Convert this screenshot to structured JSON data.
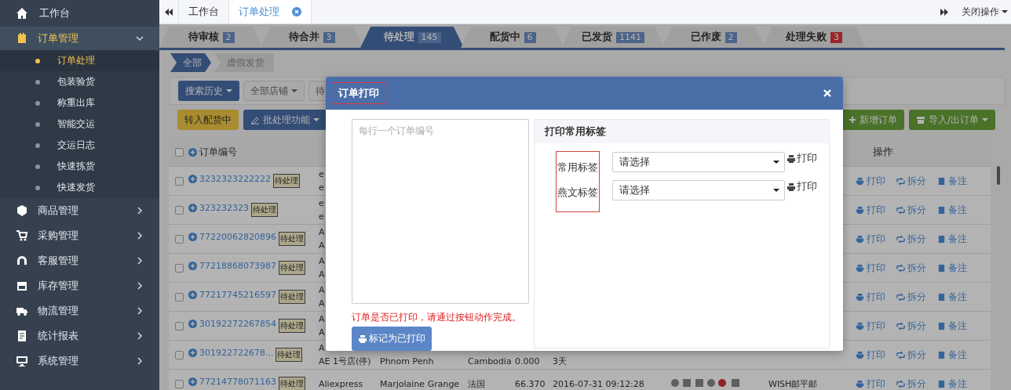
{
  "sidebar": {
    "home": {
      "label": "工作台"
    },
    "sections": [
      {
        "label": "订单管理",
        "expanded": true,
        "children": [
          {
            "label": "订单处理",
            "selected": true
          },
          {
            "label": "包装验货",
            "selected": false
          },
          {
            "label": "称重出库",
            "selected": false
          },
          {
            "label": "智能交运",
            "selected": false
          },
          {
            "label": "交运日志",
            "selected": false
          },
          {
            "label": "快速拣货",
            "selected": false
          },
          {
            "label": "快速发货",
            "selected": false
          }
        ]
      },
      {
        "label": "商品管理",
        "expanded": false
      },
      {
        "label": "采购管理",
        "expanded": false
      },
      {
        "label": "客服管理",
        "expanded": false
      },
      {
        "label": "库存管理",
        "expanded": false
      },
      {
        "label": "物流管理",
        "expanded": false
      },
      {
        "label": "统计报表",
        "expanded": false
      },
      {
        "label": "系统管理",
        "expanded": false
      }
    ]
  },
  "top_tabs": [
    {
      "label": "工作台",
      "selected": false,
      "closable": false
    },
    {
      "label": "订单处理",
      "selected": true,
      "closable": true
    }
  ],
  "top_right": {
    "menu": "关闭操作"
  },
  "status_tabs": [
    {
      "label": "待审核",
      "count": "2",
      "selected": false,
      "color": "#4c648a"
    },
    {
      "label": "待合并",
      "count": "3",
      "selected": false,
      "color": "#4c648a"
    },
    {
      "label": "待处理",
      "count": "145",
      "selected": true,
      "color": "#4c648a"
    },
    {
      "label": "配货中",
      "count": "6",
      "selected": false,
      "color": "#4c648a"
    },
    {
      "label": "已发货",
      "count": "1141",
      "selected": false,
      "color": "#4c648a"
    },
    {
      "label": "已作废",
      "count": "2",
      "selected": false,
      "color": "#4c648a"
    },
    {
      "label": "处理失败",
      "count": "3",
      "selected": false,
      "color": "#98262b"
    }
  ],
  "sub_tabs": [
    {
      "label": "全部",
      "selected": true
    },
    {
      "label": "虚假发货",
      "selected": false
    }
  ],
  "toolbar": [
    {
      "label": "搜索历史",
      "kind": "primary",
      "dropdown": true
    },
    {
      "label": "全部店铺",
      "kind": "default",
      "dropdown": true
    },
    {
      "label": "待",
      "kind": "default",
      "dropdown": false
    }
  ],
  "actions_bar": {
    "left": [
      {
        "label": "转入配货中",
        "kind": "warning",
        "dropdown": false
      },
      {
        "label": "批处理功能",
        "kind": "primary",
        "dropdown": true
      }
    ],
    "right": [
      {
        "label": "新增订单",
        "kind": "success",
        "dropdown": false
      },
      {
        "label": "导入/出订单",
        "kind": "success",
        "dropdown": true
      }
    ]
  },
  "table": {
    "select_all": {
      "checked": false
    },
    "columns": {
      "order": "订单编号",
      "actions": "操作"
    },
    "rows": [
      {
        "checked": false,
        "order": "3232323222222",
        "status": "待处理",
        "lines": [
          {
            "store": "e"
          },
          {
            "store": "e"
          }
        ],
        "actions": [
          "打印",
          "拆分",
          "备注"
        ]
      },
      {
        "checked": false,
        "order": "323232323",
        "status": "待处理",
        "lines": [
          {
            "store": "e"
          },
          {
            "store": "e"
          }
        ],
        "actions": [
          "打印",
          "拆分",
          "备注"
        ]
      },
      {
        "checked": false,
        "order": "77220062820896",
        "status": "待处理",
        "lines": [
          {
            "store": "A"
          },
          {
            "store": "A"
          }
        ],
        "actions": [
          "打印",
          "拆分",
          "备注"
        ]
      },
      {
        "checked": false,
        "order": "77218868073987",
        "status": "待处理",
        "lines": [
          {
            "store": "A"
          },
          {
            "store": "A"
          }
        ],
        "actions": [
          "打印",
          "拆分",
          "备注"
        ]
      },
      {
        "checked": false,
        "order": "77217745216597",
        "status": "待处理",
        "lines": [
          {
            "store": "A"
          },
          {
            "store": "A"
          }
        ],
        "actions": [
          "打印",
          "拆分",
          "备注"
        ]
      },
      {
        "checked": false,
        "order": "30192272267854",
        "status": "待处理",
        "lines": [
          {
            "store": "A"
          },
          {
            "store": "A"
          }
        ],
        "actions": [
          "打印",
          "拆分",
          "备注"
        ]
      },
      {
        "checked": false,
        "order": "301922722678...",
        "status": "待处理",
        "lines": [
          {
            "store": "A"
          },
          {
            "store": "AE 1号店(停)",
            "buyer": "Phnom Penh",
            "country": "Cambodia",
            "amount": "0.000",
            "time": "3天"
          }
        ],
        "actions": [
          "打印",
          "拆分",
          "备注"
        ]
      },
      {
        "checked": false,
        "order": "77214778071163",
        "status": "待处理",
        "lines": [
          {
            "store": "Aliexpress",
            "buyer": "Marjolaine Grange",
            "country": "法国",
            "amount": "66.370",
            "time": "2016-07-31 09:12:28",
            "shipping": "WISH邮平邮"
          }
        ],
        "actions": [
          "打印",
          "拆分",
          "备注"
        ]
      }
    ]
  },
  "dialog": {
    "title": "订单打印",
    "title_highlighted": true,
    "textarea": {
      "placeholder": "每行一个订单编号"
    },
    "note": "订单是否已打印，请通过按钮动作完成。",
    "mark_button": "标记为已打印",
    "panel": {
      "title": "打印常用标签",
      "labels_highlighted": true,
      "rows": [
        {
          "label": "常用标签",
          "select": "请选择",
          "action": "打印"
        },
        {
          "label": "燕文标签",
          "select": "请选择",
          "action": "打印"
        }
      ]
    }
  }
}
